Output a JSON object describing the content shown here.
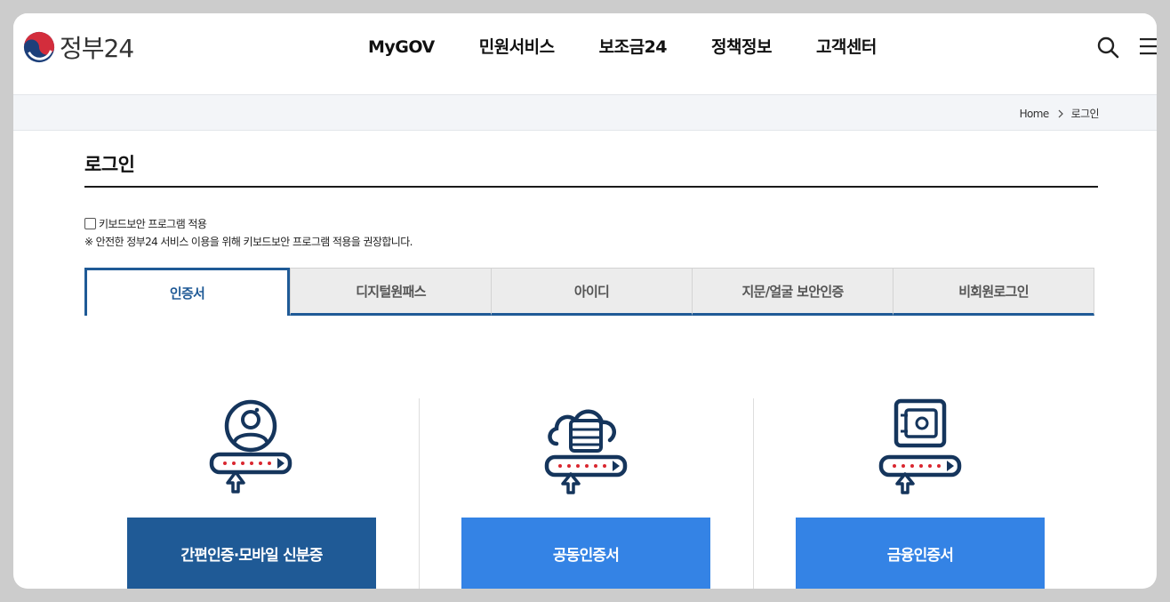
{
  "header": {
    "logo_text": "정부24",
    "nav": [
      "MyGOV",
      "민원서비스",
      "보조금24",
      "정책정보",
      "고객센터"
    ],
    "search_icon": "search-icon",
    "menu_icon": "hamburger-menu-icon"
  },
  "breadcrumb": {
    "home": "Home",
    "current": "로그인"
  },
  "page": {
    "title": "로그인",
    "keyboard_security_label": "키보드보안 프로그램 적용",
    "keyboard_security_checked": false,
    "keyboard_security_note": "※ 안전한 정부24 서비스 이용을 위해 키보드보안 프로그램 적용을 권장합니다."
  },
  "tabs": [
    {
      "label": "인증서",
      "active": true
    },
    {
      "label": "디지털원패스",
      "active": false
    },
    {
      "label": "아이디",
      "active": false
    },
    {
      "label": "지문/얼굴 보안인증",
      "active": false
    },
    {
      "label": "비회원로그인",
      "active": false
    }
  ],
  "methods": [
    {
      "label": "간편인증·모바일 신분증",
      "icon": "user-certificate-icon",
      "color": "#1f5a96"
    },
    {
      "label": "공동인증서",
      "icon": "cloud-database-certificate-icon",
      "color": "#3483e5"
    },
    {
      "label": "금융인증서",
      "icon": "safe-certificate-icon",
      "color": "#3483e5"
    }
  ],
  "colors": {
    "primary": "#1f5a96",
    "button_blue": "#3483e5",
    "icon_navy": "#15355c",
    "password_dots": "#d9262f"
  }
}
